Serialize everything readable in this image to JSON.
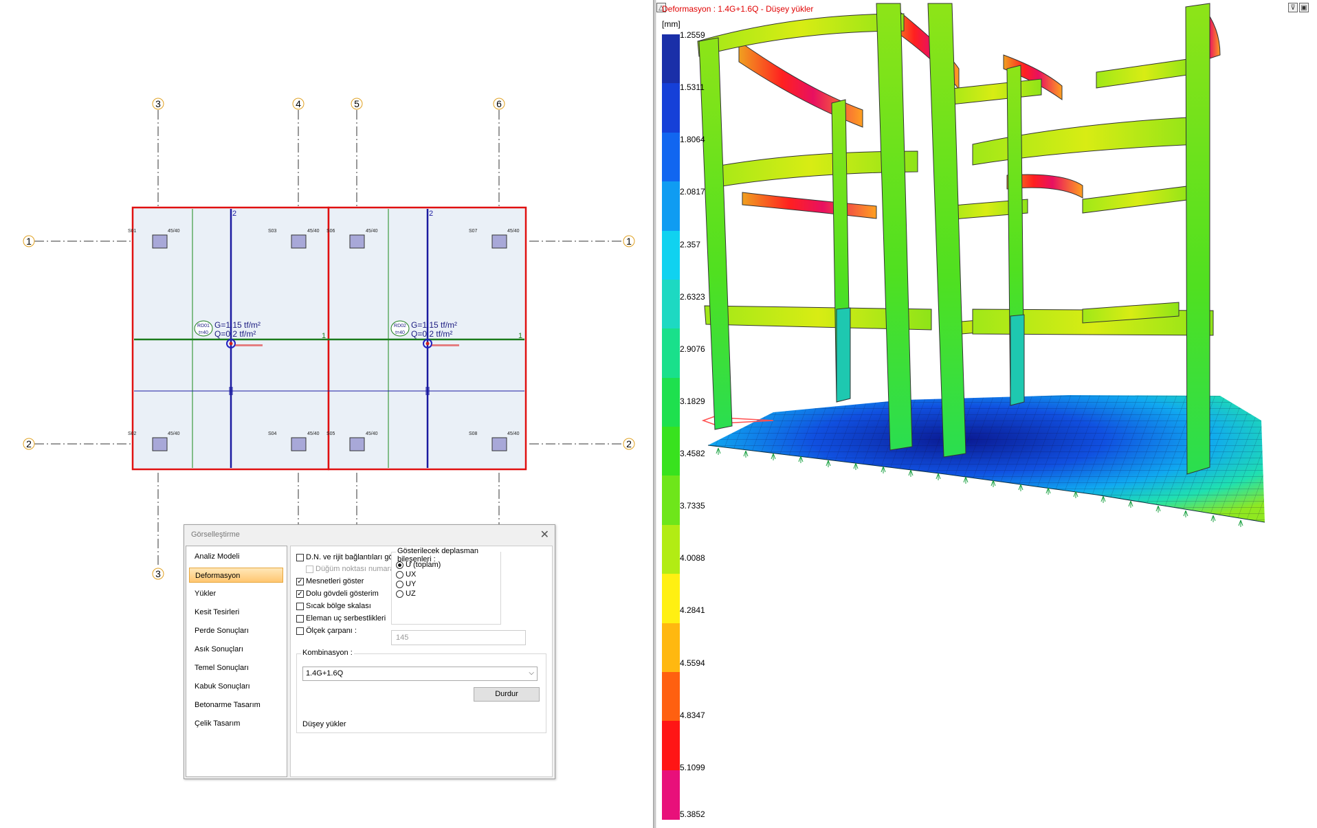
{
  "plan": {
    "axis_labels": {
      "top": [
        "3",
        "4",
        "5",
        "6"
      ],
      "left": [
        "1",
        "2"
      ],
      "right": [
        "1",
        "2"
      ],
      "bottom": [
        "3"
      ]
    },
    "columns": [
      {
        "name": "S01",
        "size": "45/40"
      },
      {
        "name": "S03",
        "size": "45/40"
      },
      {
        "name": "S06",
        "size": "45/40"
      },
      {
        "name": "S07",
        "size": "45/40"
      },
      {
        "name": "S02",
        "size": "45/40"
      },
      {
        "name": "S04",
        "size": "45/40"
      },
      {
        "name": "S05",
        "size": "45/40"
      },
      {
        "name": "S08",
        "size": "45/40"
      }
    ],
    "slabs": [
      {
        "id": "RD01",
        "thickness": "t=40",
        "g_load": "G=1.15 tf/m²",
        "q_load": "Q=0.2 tf/m²",
        "dir1": "1",
        "dir2": "2"
      },
      {
        "id": "RD02",
        "thickness": "t=40",
        "g_load": "G=1.15 tf/m²",
        "q_load": "Q=0.2 tf/m²",
        "dir1": "1",
        "dir2": "2"
      }
    ]
  },
  "dialog": {
    "title": "Görselleştirme",
    "close": "✕",
    "nav": [
      "Analiz Modeli",
      "Deformasyon",
      "Yükler",
      "Kesit Tesirleri",
      "Perde Sonuçları",
      "Asık Sonuçları",
      "Temel Sonuçları",
      "Kabuk Sonuçları",
      "Betonarme Tasarım",
      "Çelik Tasarım"
    ],
    "active_nav": "Deformasyon",
    "options": [
      {
        "label": "D.N. ve rijit bağlantıları göster",
        "checked": false,
        "enabled": true
      },
      {
        "label": "Düğüm noktası numaraları",
        "checked": false,
        "enabled": false
      },
      {
        "label": "Mesnetleri göster",
        "checked": true,
        "enabled": true
      },
      {
        "label": "Dolu gövdeli gösterim",
        "checked": true,
        "enabled": true
      },
      {
        "label": "Sıcak bölge skalası",
        "checked": false,
        "enabled": true
      },
      {
        "label": "Eleman uç serbestlikleri",
        "checked": false,
        "enabled": true
      },
      {
        "label": "Ölçek çarpanı :",
        "checked": false,
        "enabled": true
      }
    ],
    "displacement_group_title": "Gösterilecek deplasman bileşenleri :",
    "components": [
      {
        "label": "U (toplam)",
        "selected": true
      },
      {
        "label": "UX",
        "selected": false
      },
      {
        "label": "UY",
        "selected": false
      },
      {
        "label": "UZ",
        "selected": false
      }
    ],
    "scale_value": "145",
    "combination_title": "Kombinasyon :",
    "combination_value": "1.4G+1.6Q",
    "stop_button": "Durdur",
    "load_case": "Düşey yükler"
  },
  "model_view": {
    "header": "Deformasyon : 1.4G+1.6Q  -  Düşey yükler",
    "unit": "[mm]",
    "legend_values": [
      "1.2559",
      "1.5311",
      "1.8064",
      "2.0817",
      "2.357",
      "2.6323",
      "2.9076",
      "3.1829",
      "3.4582",
      "3.7335",
      "4.0088",
      "4.2841",
      "4.5594",
      "4.8347",
      "5.1099",
      "5.3852"
    ],
    "legend_colors": [
      "#1a2fa8",
      "#1540d8",
      "#1166f0",
      "#0f9cf2",
      "#10d2f0",
      "#1dd9c2",
      "#19e08b",
      "#1ee04e",
      "#38e21e",
      "#6ee61a",
      "#b2ec14",
      "#fff012",
      "#ffb810",
      "#ff6010",
      "#ff1515",
      "#e8107a"
    ]
  }
}
